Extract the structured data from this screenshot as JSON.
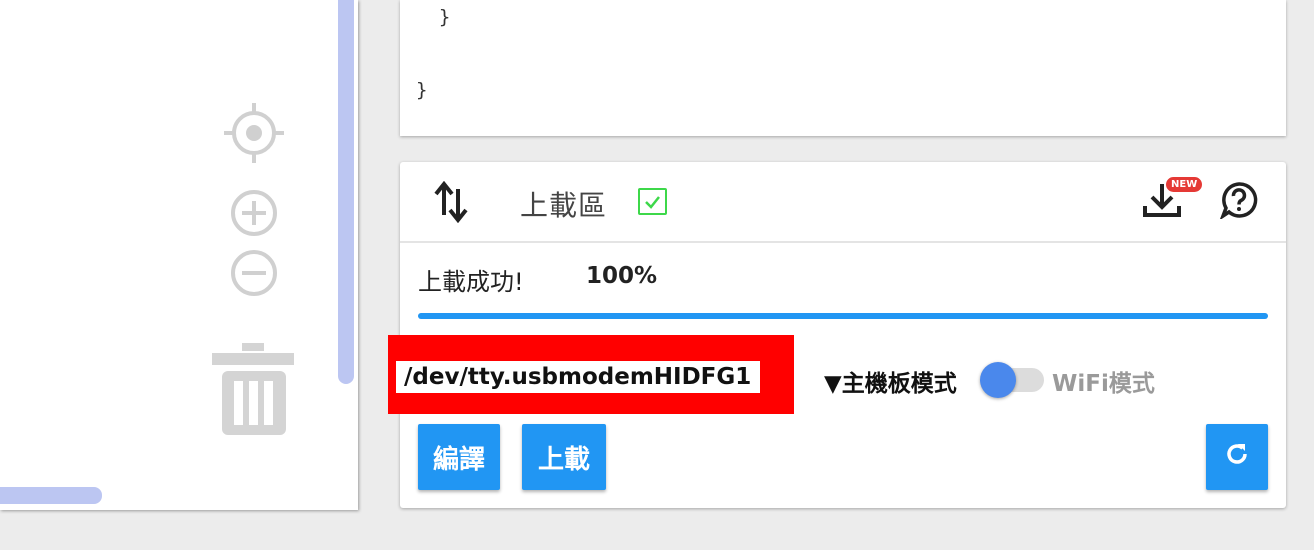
{
  "code": {
    "lines": [
      "  }",
      "}"
    ]
  },
  "workspace": {
    "icons": [
      "crosshair-icon",
      "zoom-in-icon",
      "zoom-out-icon",
      "trash-icon"
    ]
  },
  "upload": {
    "title": "上載區",
    "status_text": "上載成功!",
    "percent_text": "100%",
    "progress": 1.0,
    "new_badge": "NEW",
    "port_value": "/dev/tty.usbmodemHIDFG1",
    "mode_label": "▼主機板模式",
    "wifi_label": "WiFi模式",
    "compile_label": "編譯",
    "upload_label": "上載"
  },
  "colors": {
    "accent": "#2196f3",
    "highlight_frame": "#ff0000",
    "scrollbar": "#bcc6f2",
    "check": "#3dd84a",
    "badge": "#e53935"
  }
}
